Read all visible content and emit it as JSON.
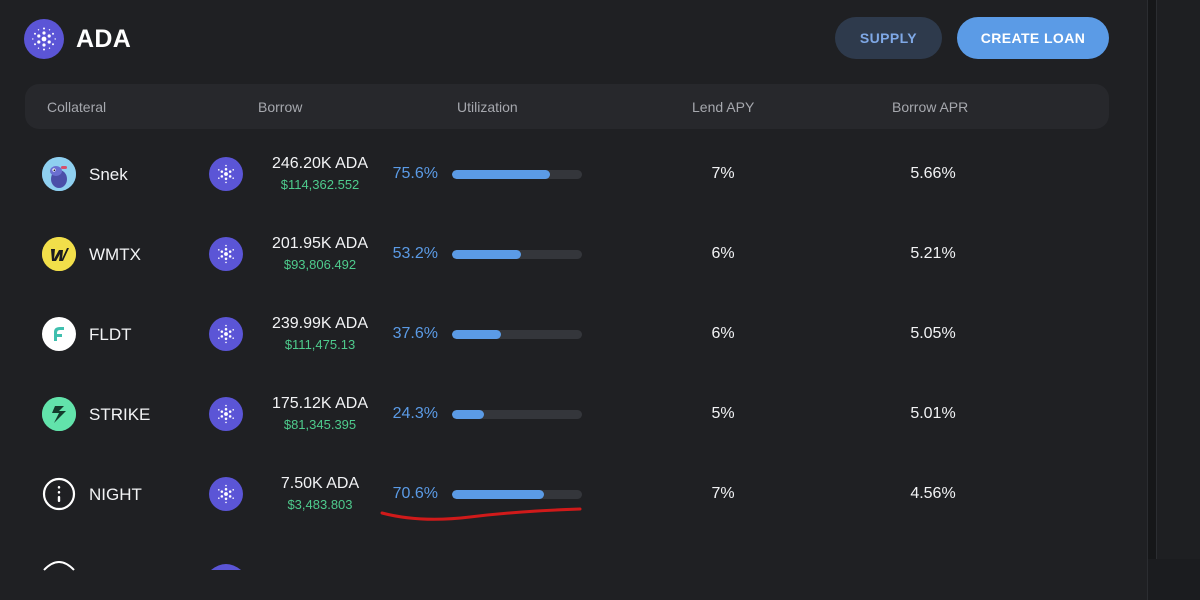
{
  "header": {
    "asset": "ADA",
    "supply_label": "SUPPLY",
    "create_loan_label": "CREATE LOAN"
  },
  "table": {
    "columns": {
      "collateral": "Collateral",
      "borrow": "Borrow",
      "utilization": "Utilization",
      "lend_apy": "Lend APY",
      "borrow_apr": "Borrow APR"
    },
    "rows": [
      {
        "collateral": "Snek",
        "icon": "snek-icon",
        "borrow": "246.20K ADA",
        "borrow_usd": "$114,362.552",
        "utilization": "75.6%",
        "utilization_value": 75.6,
        "lend_apy": "7%",
        "borrow_apr": "5.66%"
      },
      {
        "collateral": "WMTX",
        "icon": "wmtx-icon",
        "borrow": "201.95K ADA",
        "borrow_usd": "$93,806.492",
        "utilization": "53.2%",
        "utilization_value": 53.2,
        "lend_apy": "6%",
        "borrow_apr": "5.21%"
      },
      {
        "collateral": "FLDT",
        "icon": "fldt-icon",
        "borrow": "239.99K ADA",
        "borrow_usd": "$111,475.13",
        "utilization": "37.6%",
        "utilization_value": 37.6,
        "lend_apy": "6%",
        "borrow_apr": "5.05%"
      },
      {
        "collateral": "STRIKE",
        "icon": "strike-icon",
        "borrow": "175.12K ADA",
        "borrow_usd": "$81,345.395",
        "utilization": "24.3%",
        "utilization_value": 24.3,
        "lend_apy": "5%",
        "borrow_apr": "5.01%"
      },
      {
        "collateral": "NIGHT",
        "icon": "night-icon",
        "borrow": "7.50K ADA",
        "borrow_usd": "$3,483.803",
        "utilization": "70.6%",
        "utilization_value": 70.6,
        "lend_apy": "7%",
        "borrow_apr": "4.56%"
      }
    ]
  },
  "colors": {
    "accent": "#5b9be6",
    "usd_green": "#4ecb8d",
    "ada_purple": "#5b55d6",
    "annotation_red": "#d01a1a"
  }
}
